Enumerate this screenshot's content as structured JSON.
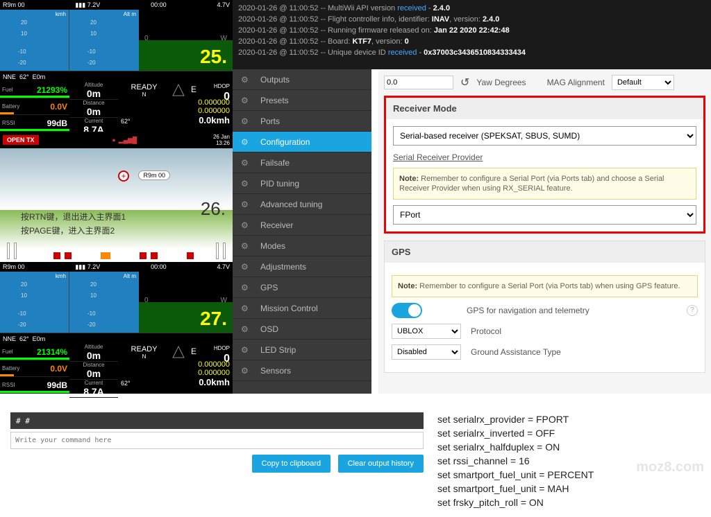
{
  "telemetry": {
    "topbar": {
      "model": "R9m 00",
      "volt1": "7.2V",
      "time": "00:00",
      "volt2": "4.7V"
    },
    "hud": {
      "kmh": "kmh",
      "altm": "Alt m",
      "ticks": [
        "20",
        "10",
        "-10",
        "-20"
      ]
    },
    "compass": {
      "n": "N",
      "ne": "NE",
      "deg": "62°",
      "e": "E",
      "w": "W",
      "zero": "0",
      "zerom": "0m"
    },
    "stats1": {
      "fuel_lbl": "Fuel",
      "fuel": "21293%",
      "batt_lbl": "Battery",
      "batt": "0.0V",
      "rssi_lbl": "RSSI",
      "rssi": "99dB",
      "alt_lbl": "Altitude",
      "alt": "0m",
      "dist_lbl": "Distance",
      "dist": "0m",
      "cur_lbl": "Current",
      "cur": "8.7A",
      "ready": "READY",
      "n": "N",
      "hdop": "HDOP",
      "gpsn": "0",
      "y1": "0.000000",
      "y2": "0.000000",
      "speed": "0.0kmh",
      "heading": "62°"
    },
    "stats2": {
      "fuel_lbl": "Fuel",
      "fuel": "21314%",
      "batt_lbl": "Battery",
      "batt": "0.0V",
      "rssi_lbl": "RSSI",
      "rssi": "99dB",
      "alt_lbl": "Altitude",
      "alt": "0m",
      "dist_lbl": "Distance",
      "dist": "0m",
      "cur_lbl": "Current",
      "cur": "8.7A",
      "ready": "READY",
      "n": "N",
      "hdop": "HDOP",
      "gpsn": "0",
      "y1": "0.000000",
      "y2": "0.000000",
      "speed": "0.0kmh",
      "heading": "62°"
    },
    "big25": "25.",
    "big27": "27."
  },
  "tx": {
    "badge": "OPEN\nTX",
    "date": "26 Jan",
    "time": "13:26",
    "r9": "R9m 00",
    "line1": "按RTN键，退出进入主界面1",
    "line2": "按PAGE键，进入主界面2",
    "big": "26."
  },
  "log": {
    "l1_pre": "2020-01-26 @ 11:00:52 -- MultiWii API version ",
    "l1_hl": "received",
    "l1_post": " - ",
    "l1_b": "2.4.0",
    "l2_pre": "2020-01-26 @ 11:00:52 -- Flight controller info, identifier: ",
    "l2_b1": "INAV",
    "l2_mid": ", version: ",
    "l2_b2": "2.4.0",
    "l3_pre": "2020-01-26 @ 11:00:52 -- Running firmware released on: ",
    "l3_b": "Jan 22 2020 22:42:48",
    "l4_pre": "2020-01-26 @ 11:00:52 -- Board: ",
    "l4_b1": "KTF7",
    "l4_mid": ", version: ",
    "l4_b2": "0",
    "l5_pre": "2020-01-26 @ 11:00:52 -- Unique device ID ",
    "l5_hl": "received",
    "l5_post": " - ",
    "l5_b": "0x37003c3436510834333434"
  },
  "nav": [
    "Outputs",
    "Presets",
    "Ports",
    "Configuration",
    "Failsafe",
    "PID tuning",
    "Advanced tuning",
    "Receiver",
    "Modes",
    "Adjustments",
    "GPS",
    "Mission Control",
    "OSD",
    "LED Strip",
    "Sensors"
  ],
  "nav_active": 3,
  "cfg": {
    "top_val": "0.0",
    "yaw_ico": "↺",
    "yaw_lbl": "Yaw Degrees",
    "mag_lbl": "MAG Alignment",
    "mag_sel": "Default",
    "rx_title": "Receiver Mode",
    "rx_sel": "Serial-based receiver (SPEKSAT, SBUS, SUMD)",
    "srp_lbl": "Serial Receiver Provider",
    "note1_b": "Note:",
    "note1": " Remember to configure a Serial Port (via Ports tab) and choose a Serial Receiver Provider when using RX_SERIAL feature.",
    "srp_sel": "FPort",
    "gps_title": "GPS",
    "note2_b": "Note:",
    "note2": " Remember to configure a Serial Port (via Ports tab) when using GPS feature.",
    "gps_nav": "GPS for navigation and telemetry",
    "proto_sel": "UBLOX",
    "proto_lbl": "Protocol",
    "gat_sel": "Disabled",
    "gat_lbl": "Ground Assistance Type"
  },
  "cli": {
    "out": "# #",
    "ph": "Write your command here",
    "copy": "Copy to clipboard",
    "clear": "Clear output history"
  },
  "cmds": [
    "set serialrx_provider = FPORT",
    "set serialrx_inverted = OFF",
    "set serialrx_halfduplex = ON",
    "set rssi_channel = 16",
    "set smartport_fuel_unit = PERCENT",
    "set smartport_fuel_unit = MAH",
    "set frsky_pitch_roll = ON"
  ],
  "watermark": "moz8.com"
}
